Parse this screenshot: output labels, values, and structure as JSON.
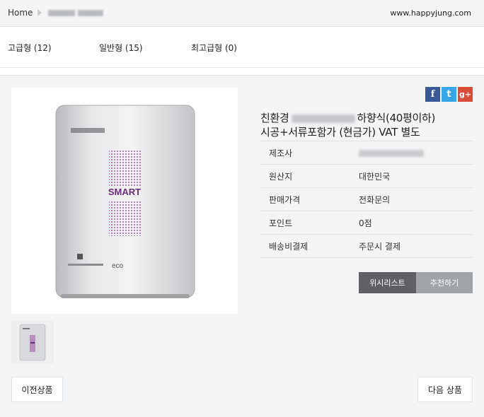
{
  "breadcrumb": {
    "home": "Home"
  },
  "header": {
    "site_url": "www.happyjung.com"
  },
  "categories": [
    {
      "label": "고급형 (12)"
    },
    {
      "label": "일반형 (15)"
    },
    {
      "label": "최고급형 (0)"
    }
  ],
  "product": {
    "title_prefix": "친환경",
    "title_suffix": "하향식(40평이하)",
    "title_line2": "시공+서류포함가 (현금가) VAT 별도",
    "image_label": "SMART",
    "image_brand_mark": "eco",
    "info": [
      {
        "key": "제조사",
        "value": ""
      },
      {
        "key": "원산지",
        "value": "대한민국"
      },
      {
        "key": "판매가격",
        "value": "전화문의"
      },
      {
        "key": "포인트",
        "value": "0점"
      },
      {
        "key": "배송비결제",
        "value": "주문시 결제"
      }
    ]
  },
  "buttons": {
    "wishlist": "위시리스트",
    "recommend": "추천하기",
    "prev": "이전상품",
    "next": "다음 상품"
  },
  "share": {
    "facebook": "f",
    "twitter": "t",
    "google": "g+"
  },
  "colors": {
    "dark_button": "#5f6166",
    "light_button": "#a0a3a8",
    "facebook": "#3b5998",
    "twitter": "#35a6e8",
    "google": "#dd4b39"
  }
}
